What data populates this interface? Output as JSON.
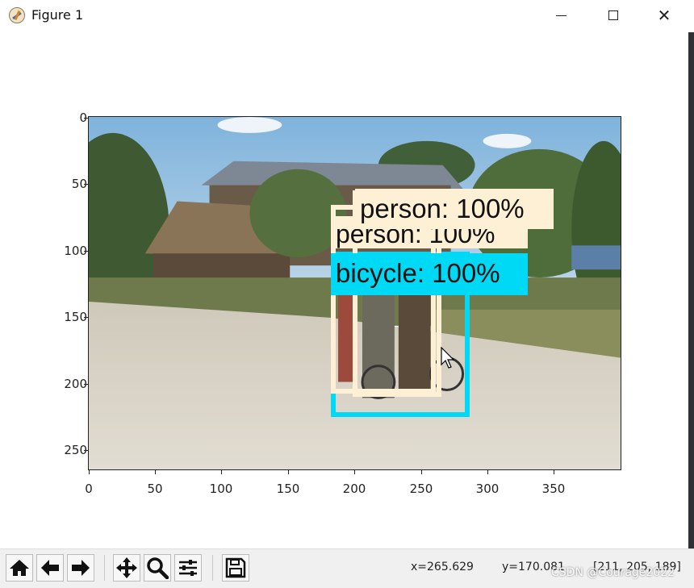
{
  "window": {
    "title": "Figure 1",
    "buttons": {
      "minimize": "minimize-icon",
      "maximize": "maximize-icon",
      "close": "close-icon"
    }
  },
  "axes": {
    "y_ticks": [
      "0",
      "50",
      "100",
      "150",
      "200",
      "250"
    ],
    "x_ticks": [
      "0",
      "50",
      "100",
      "150",
      "200",
      "250",
      "300",
      "350"
    ]
  },
  "detections": [
    {
      "label": "person: 100%",
      "class": "person",
      "color": "#fdf0d5"
    },
    {
      "label": "person: 100%",
      "class": "person",
      "color": "#fdf0d5"
    },
    {
      "label": "bicycle: 100%",
      "class": "bicycle",
      "color": "#00d9f5"
    }
  ],
  "toolbar": {
    "icons": [
      "home-icon",
      "back-arrow-icon",
      "forward-arrow-icon",
      "pan-icon",
      "zoom-icon",
      "configure-subplots-icon",
      "save-icon"
    ]
  },
  "status": {
    "x": "x=265.629",
    "y": "y=170.081",
    "rgb": "[211, 205, 189]"
  },
  "watermark": "CSDN @Courage2022"
}
